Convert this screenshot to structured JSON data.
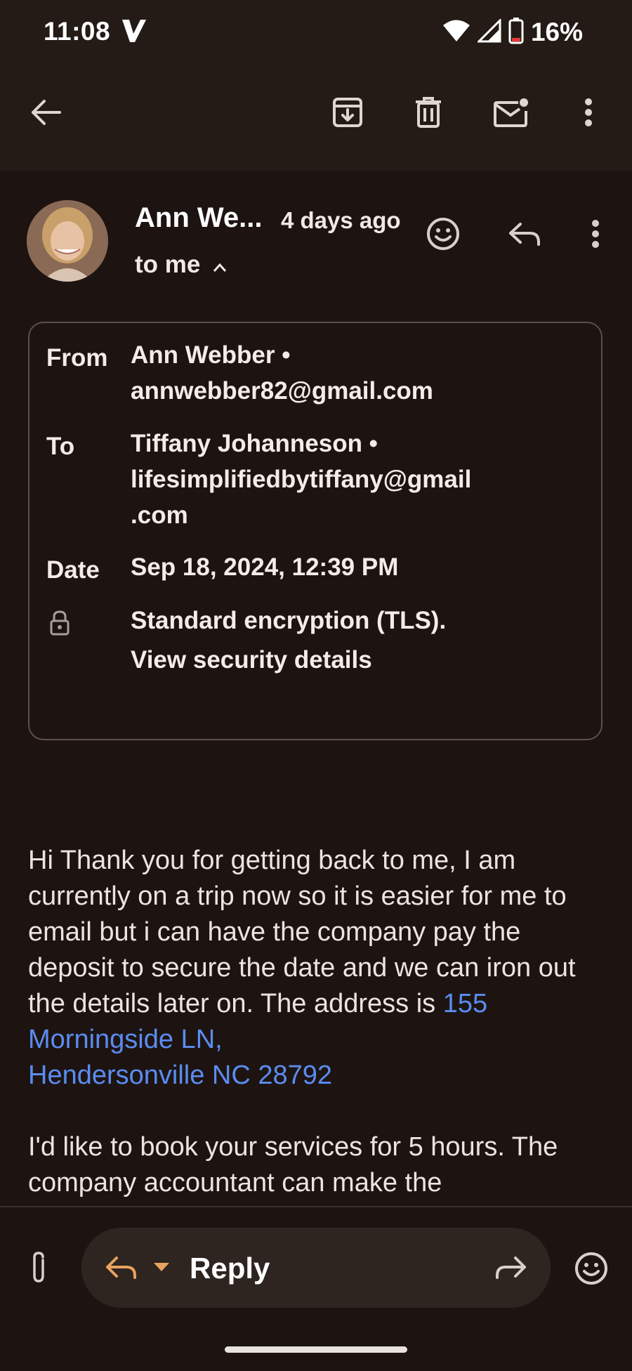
{
  "status_bar": {
    "time": "11:08",
    "carrier_logo": "V",
    "battery_percent": "16%"
  },
  "app_bar": {
    "icons": [
      "back-arrow-icon",
      "archive-icon",
      "delete-icon",
      "mark-unread-icon",
      "more-vert-icon"
    ]
  },
  "message": {
    "sender_short": "Ann We...",
    "time_ago": "4 days ago",
    "recipient_summary": "to me",
    "details": {
      "from_label": "From",
      "from_value": "Ann Webber •",
      "from_email": "annwebber82@gmail.com",
      "to_label": "To",
      "to_value": "Tiffany Johanneson •",
      "to_email_line1": "lifesimplifiedbytiffany@gmail",
      "to_email_line2": ".com",
      "date_label": "Date",
      "date_value": "Sep 18, 2024, 12:39 PM",
      "security_line1": "Standard encryption (TLS).",
      "security_line2": "View security details"
    },
    "body": {
      "para1_text": "Hi Thank you for getting back to me, I am currently on a trip now so it is easier for me to email but i can have the company pay the deposit to secure the date and we can iron out the details later on.  The address is ",
      "address_line1": "155 Morningside LN,",
      "address_line2": "Hendersonville NC 28792",
      "para2_text": "I'd like to book your services for 5 hours. The company accountant can make the"
    }
  },
  "compose_bar": {
    "reply_label": "Reply"
  },
  "colors": {
    "background": "#1d1411",
    "bar": "#241b16",
    "accent": "#e8a25f",
    "link": "#5b8cf0"
  }
}
